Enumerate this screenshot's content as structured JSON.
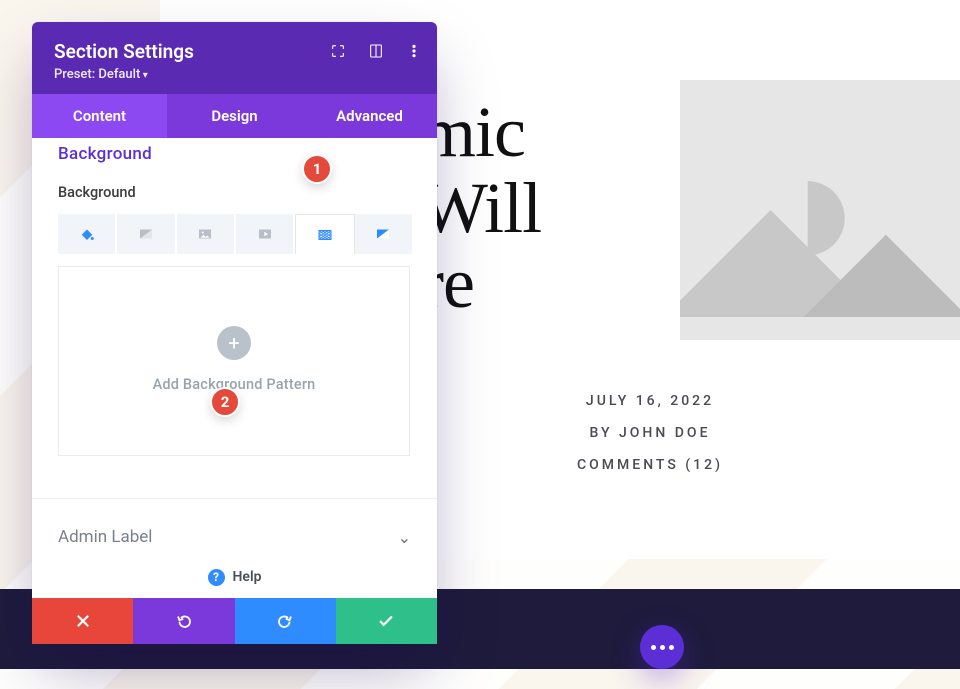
{
  "page": {
    "title_visible_fragment_1": "mic",
    "title_visible_fragment_2": "Will",
    "title_visible_fragment_3": "re",
    "meta_date": "JULY 16, 2022",
    "meta_author": "BY JOHN DOE",
    "meta_comments": "COMMENTS (12)"
  },
  "panel": {
    "title": "Section Settings",
    "preset_label": "Preset: Default",
    "tabs": [
      "Content",
      "Design",
      "Advanced"
    ],
    "active_tab": 0,
    "accordion_cut_label": "Background",
    "section_label": "Background",
    "bg_tab_icons": [
      "fill-icon",
      "gradient-icon",
      "image-icon",
      "video-icon",
      "pattern-icon",
      "mask-icon"
    ],
    "bg_tab_active_index": 4,
    "add_pattern_label": "Add Background Pattern",
    "admin_label": "Admin Label",
    "help_label": "Help",
    "badges": {
      "one": "1",
      "two": "2"
    }
  }
}
